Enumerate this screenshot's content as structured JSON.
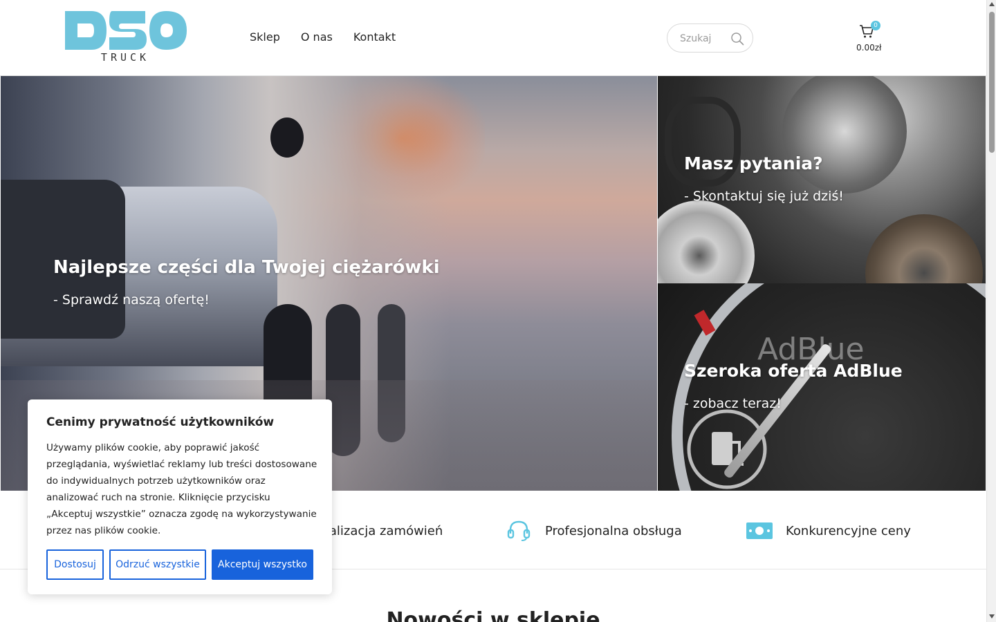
{
  "header": {
    "logo_text": "TRUCK",
    "nav": [
      "Sklep",
      "O nas",
      "Kontakt"
    ],
    "search_placeholder": "Szukaj",
    "cart_count": "0",
    "cart_total": "0.00zł"
  },
  "hero": {
    "main": {
      "title": "Najlepsze części dla Twojej ciężarówki",
      "subtitle": "- Sprawdź naszą ofertę!"
    },
    "parts": {
      "title": "Masz pytania?",
      "subtitle": "- Skontaktuj się już dziś!"
    },
    "adblue": {
      "title": "Szeroka oferta AdBlue",
      "subtitle": "- zobacz teraz!",
      "image_text": "AdBlue"
    }
  },
  "features": [
    {
      "icon": "truck-icon",
      "label": "Szybka realizacja zamówień"
    },
    {
      "icon": "headset-icon",
      "label": "Profesjonalna obsługa"
    },
    {
      "icon": "money-icon",
      "label": "Konkurencyjne ceny"
    }
  ],
  "section_title": "Nowości w sklepie",
  "cookie": {
    "title": "Cenimy prywatność użytkowników",
    "text": "Używamy plików cookie, aby poprawić jakość przeglądania, wyświetlać reklamy lub treści dostosowane do indywidualnych potrzeb użytkowników oraz analizować ruch na stronie. Kliknięcie przycisku „Akceptuj wszystkie” oznacza zgodę na wykorzystywanie przez nas plików cookie.",
    "buttons": {
      "customize": "Dostosuj",
      "reject": "Odrzuć wszystkie",
      "accept": "Akceptuj wszystko"
    }
  },
  "colors": {
    "accent": "#5bc5e0",
    "cookie_primary": "#1863dc"
  }
}
